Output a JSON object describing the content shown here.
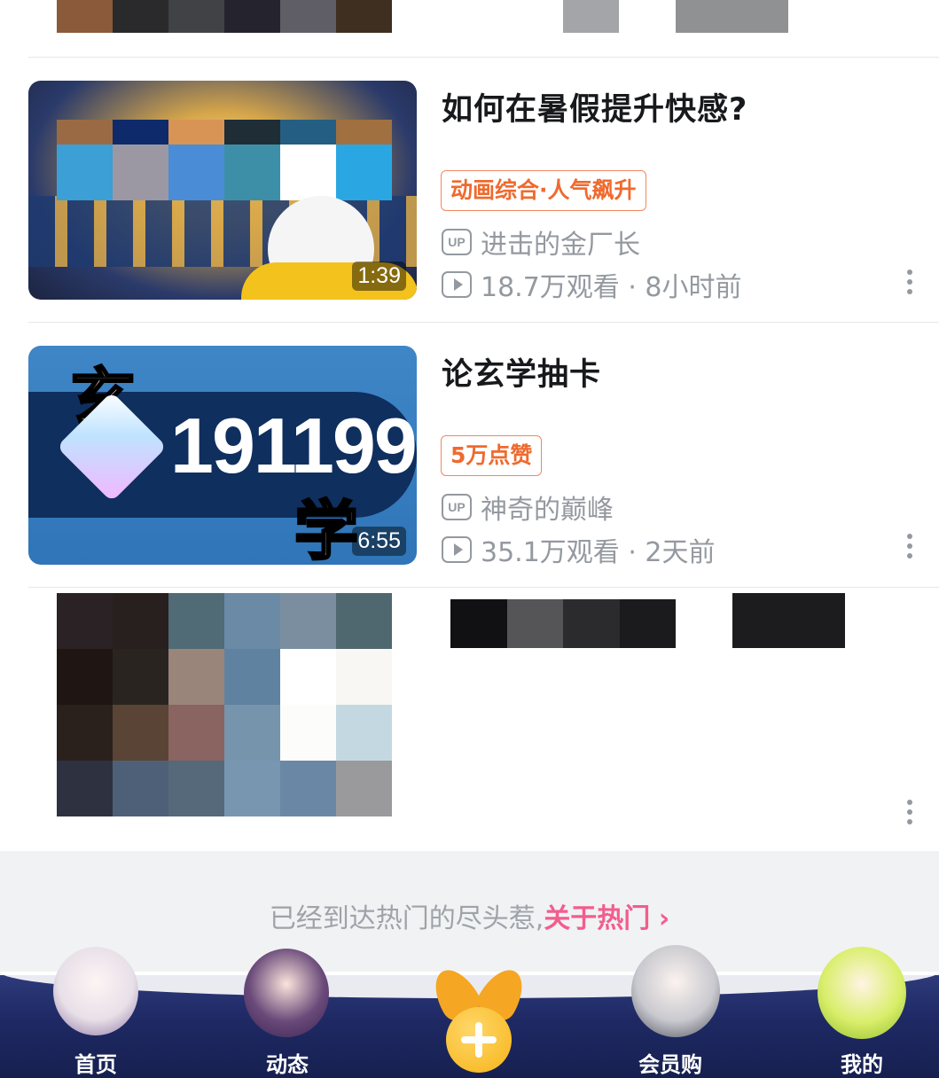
{
  "feed": {
    "items": [
      {
        "title": "如何在暑假提升快感?",
        "tag": "动画综合·人气飙升",
        "uploader": "进击的金厂长",
        "stats": "18.7万观看 · 8小时前",
        "duration": "1:39"
      },
      {
        "title": "论玄学抽卡",
        "tag": "5万点赞",
        "uploader": "神奇的巅峰",
        "stats": "35.1万观看 · 2天前",
        "duration": "6:55",
        "thumb_text": "191199",
        "thumb_glyph_top": "玄",
        "thumb_glyph_bottom": "学"
      }
    ],
    "up_badge": "UP"
  },
  "end_message": {
    "text": "已经到达热门的尽头惹,",
    "link": "关于热门",
    "chevron": "›"
  },
  "tabbar": {
    "tabs": [
      "首页",
      "动态",
      "会员购",
      "我的"
    ],
    "center_icon": "plus-icon"
  },
  "colors": {
    "tag_orange": "#ef6a2e",
    "link_pink": "#f25d8e",
    "tabbar_navy": "#1f2a66",
    "center_gold": "#f6b417"
  }
}
